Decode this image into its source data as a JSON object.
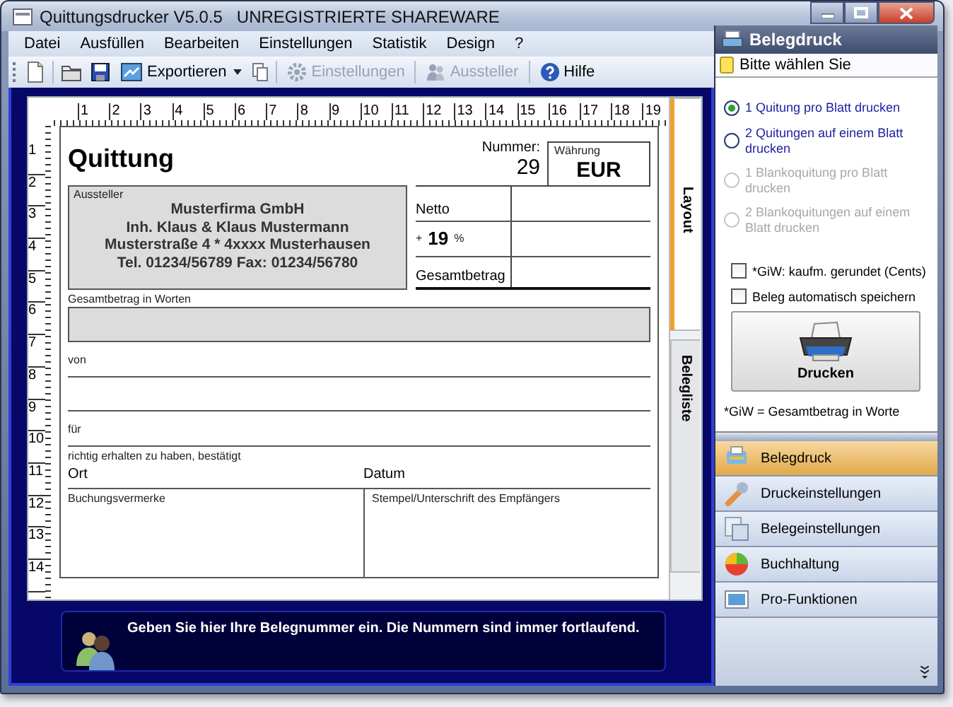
{
  "window": {
    "title": "Quittungsdrucker V5.0.5   UNREGISTRIERTE SHAREWARE"
  },
  "menu": [
    "Datei",
    "Ausfüllen",
    "Bearbeiten",
    "Einstellungen",
    "Statistik",
    "Design",
    "?"
  ],
  "toolbar": [
    {
      "label": "Exportieren",
      "dropdown": true,
      "disabled": false
    },
    {
      "label": "Einstellungen",
      "dropdown": false,
      "disabled": true
    },
    {
      "label": "Aussteller",
      "dropdown": false,
      "disabled": true
    },
    {
      "label": "Hilfe",
      "dropdown": false,
      "disabled": false
    }
  ],
  "ruler": {
    "horizontal": [
      "1",
      "2",
      "3",
      "4",
      "5",
      "6",
      "7",
      "8",
      "9",
      "10",
      "11",
      "12",
      "13",
      "14",
      "15",
      "16",
      "17",
      "18",
      "19"
    ],
    "vertical": [
      "1",
      "2",
      "3",
      "4",
      "5",
      "6",
      "7",
      "8",
      "9",
      "10",
      "11",
      "12",
      "13",
      "14"
    ]
  },
  "form": {
    "title": "Quittung",
    "number_label": "Nummer:",
    "number": "29",
    "currency_label": "Währung",
    "currency": "EUR",
    "issuer_label": "Aussteller",
    "issuer_lines": [
      "Musterfirma GmbH",
      "Inh. Klaus & Klaus Mustermann",
      "Musterstraße 4  *  4xxxx Musterhausen",
      "Tel. 01234/56789  Fax: 01234/56780"
    ],
    "net_label": "Netto",
    "tax_sign": "+",
    "tax_rate": "19",
    "tax_unit": "%",
    "total_label": "Gesamtbetrag",
    "words_label": "Gesamtbetrag in Worten",
    "from_label": "von",
    "for_label": "für",
    "confirm_label": "richtig erhalten zu haben, bestätigt",
    "place_label": "Ort",
    "date_label": "Datum",
    "notes_label": "Buchungsvermerke",
    "signature_label": "Stempel/Unterschrift des Empfängers"
  },
  "side_tabs": [
    {
      "label": "Layout",
      "selected": true
    },
    {
      "label": "Belegliste",
      "selected": false
    }
  ],
  "hint": "Geben Sie hier Ihre Belegnummer ein. Die Nummern sind immer fortlaufend.",
  "panel": {
    "title": "Belegdruck",
    "prompt": "Bitte wählen Sie",
    "options": [
      {
        "label": "1 Quitung pro Blatt drucken",
        "selected": true,
        "disabled": false
      },
      {
        "label": "2 Quitungen auf einem Blatt drucken",
        "selected": false,
        "disabled": false
      },
      {
        "label": "1 Blankoquitung pro Blatt drucken",
        "selected": false,
        "disabled": true
      },
      {
        "label": "2 Blankoquitungen auf einem Blatt drucken",
        "selected": false,
        "disabled": true
      }
    ],
    "checkboxes": [
      {
        "label": "*GiW: kaufm. gerundet (Cents)",
        "checked": false
      },
      {
        "label": "Beleg automatisch speichern",
        "checked": false
      }
    ],
    "print_button": "Drucken",
    "footnote": "*GiW = Gesamtbetrag in Worte"
  },
  "nav": [
    {
      "label": "Belegdruck",
      "selected": true
    },
    {
      "label": "Druckeinstellungen",
      "selected": false
    },
    {
      "label": "Belegeinstellungen",
      "selected": false
    },
    {
      "label": "Buchhaltung",
      "selected": false
    },
    {
      "label": "Pro-Funktionen",
      "selected": false
    }
  ]
}
